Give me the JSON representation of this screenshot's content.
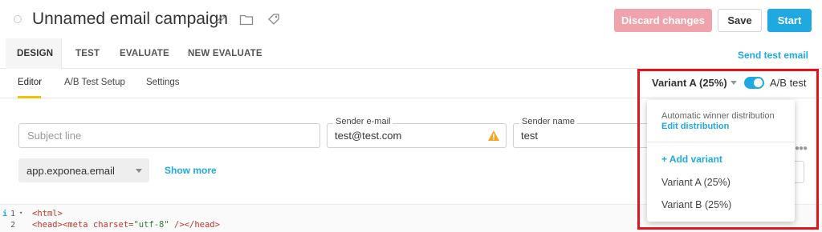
{
  "header": {
    "title": "Unnamed email campaign",
    "discard_label": "Discard changes",
    "save_label": "Save",
    "start_label": "Start"
  },
  "tabs": [
    {
      "label": "DESIGN",
      "active": true
    },
    {
      "label": "TEST",
      "active": false
    },
    {
      "label": "EVALUATE",
      "active": false
    },
    {
      "label": "NEW EVALUATE",
      "active": false
    }
  ],
  "send_test_label": "Send test email",
  "subtabs": [
    {
      "label": "Editor",
      "active": true
    },
    {
      "label": "A/B Test Setup",
      "active": false
    },
    {
      "label": "Settings",
      "active": false
    }
  ],
  "variant_selector": {
    "selected": "Variant A (25%)",
    "ab_toggle_label": "A/B test",
    "ab_toggle_on": true
  },
  "form": {
    "subject_placeholder": "Subject line",
    "sender_email_label": "Sender e-mail",
    "sender_email_value": "test@test.com",
    "sender_name_label": "Sender name",
    "sender_name_value": "test",
    "domain_value": "app.exponea.email",
    "show_more_label": "Show more"
  },
  "dropdown": {
    "distribution_label": "Automatic winner distribution",
    "edit_distribution_label": "Edit distribution",
    "add_variant_label": "+ Add variant",
    "variants": [
      "Variant A (25%)",
      "Variant B (25%)"
    ]
  },
  "code": {
    "gutter_info": "i",
    "line_numbers": [
      "1",
      "2"
    ],
    "line1": "<html>",
    "line2_head_open": "<head>",
    "line2_meta_open": "<meta ",
    "line2_attr": "charset=",
    "line2_str": "\"utf-8\"",
    "line2_close": " /></head>"
  },
  "colors": {
    "accent": "#1fa9e1",
    "discard_bg": "#f0a3ad",
    "warning": "#f5a623",
    "highlight": "#e3141b",
    "active_underline": "#f2c300"
  },
  "icons": {
    "title_actions": [
      "pencil-icon",
      "folder-icon",
      "tag-icon"
    ],
    "warning": "warning-icon"
  }
}
